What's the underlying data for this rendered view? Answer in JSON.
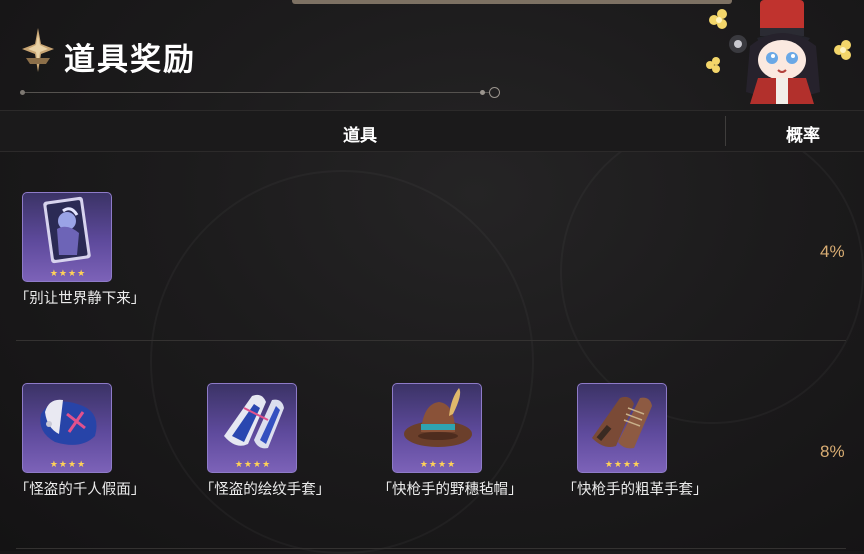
{
  "header": {
    "title": "道具奖励",
    "title_icon": "wish-star-icon"
  },
  "table": {
    "col_item": "道具",
    "col_probability": "概率"
  },
  "rows": [
    {
      "probability": "4%",
      "items": [
        {
          "name": "「别让世界静下来」",
          "stars": "★★★★",
          "icon": "light-cone-card-icon"
        }
      ]
    },
    {
      "probability": "8%",
      "items": [
        {
          "name": "「怪盗的千人假面」",
          "stars": "★★★★",
          "icon": "mask-relic-icon"
        },
        {
          "name": "「怪盗的绘纹手套」",
          "stars": "★★★★",
          "icon": "gloves-relic-icon"
        },
        {
          "name": "「快枪手的野穗毡帽」",
          "stars": "★★★★",
          "icon": "cowboy-hat-relic-icon"
        },
        {
          "name": "「快枪手的粗革手套」",
          "stars": "★★★★",
          "icon": "leather-gloves-relic-icon"
        }
      ]
    }
  ],
  "colors": {
    "accent_gold": "#d9ad73",
    "card_purple": "#5e4a9c",
    "star": "#ffd257"
  }
}
